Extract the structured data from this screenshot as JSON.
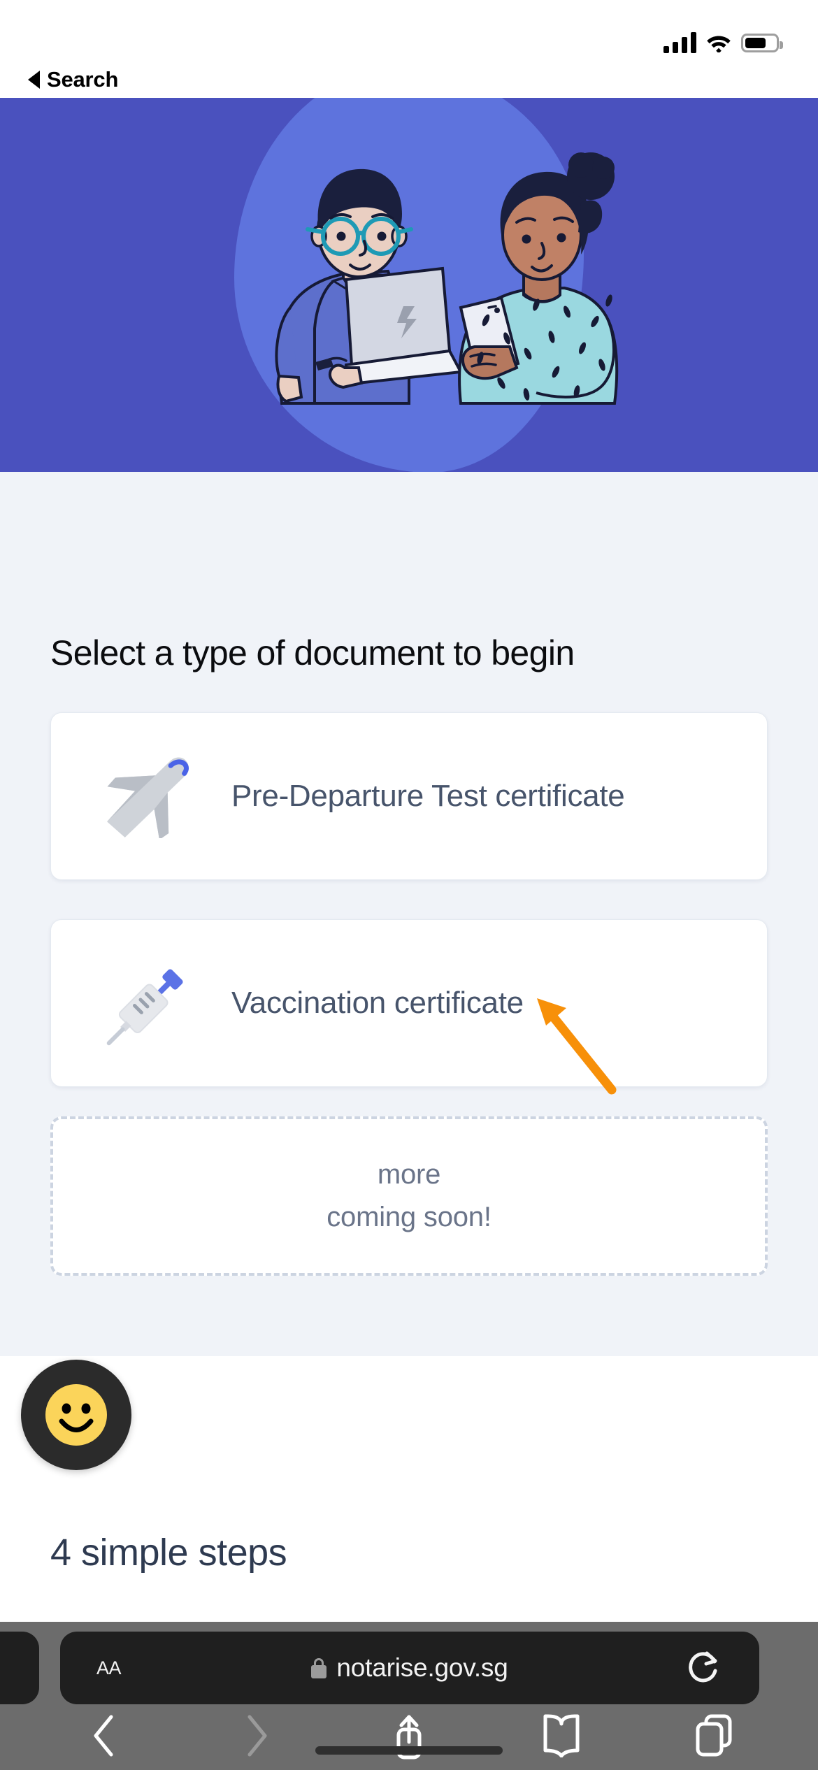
{
  "status_bar": {
    "signal_icon": "cellular-bars-icon",
    "wifi_icon": "wifi-icon",
    "battery_icon": "battery-icon"
  },
  "back_link": {
    "label": "Search",
    "icon": "back-triangle-icon"
  },
  "hero": {
    "background_color": "#4a51be",
    "blob_color": "#5e73dd",
    "illustration": "two-people-with-laptop-and-phone-illustration"
  },
  "page": {
    "background_color": "#f0f3f8",
    "heading": "Select a type of document to begin",
    "cards": [
      {
        "label": "Pre-Departure Test certificate",
        "icon": "airplane-icon",
        "icon_color": "#c9cdd3",
        "accent_color": "#4a63e7"
      },
      {
        "label": "Vaccination certificate",
        "icon": "syringe-icon",
        "icon_color": "#e3e5e9",
        "accent_color": "#5b72e6"
      }
    ],
    "coming_soon": {
      "line1": "more",
      "line2": "coming soon!",
      "border_color": "#ccd4e1",
      "text_color": "#6a7489"
    },
    "steps_title": "4 simple steps",
    "feedback_widget": {
      "icon": "smiley-face-icon",
      "face_color": "#fbd45a",
      "ring_color": "#2b2b2b"
    }
  },
  "annotation": {
    "arrow_icon": "orange-pointer-arrow-icon",
    "color": "#f79009",
    "points_to": "Vaccination certificate"
  },
  "safari": {
    "url": "notarise.gov.sg",
    "lock_icon": "lock-icon",
    "text_size_label": "AA",
    "reload_icon": "reload-icon",
    "toolbar": [
      {
        "name": "back",
        "icon": "chevron-left-icon",
        "enabled": true
      },
      {
        "name": "forward",
        "icon": "chevron-right-icon",
        "enabled": false
      },
      {
        "name": "share",
        "icon": "share-icon",
        "enabled": true
      },
      {
        "name": "bookmarks",
        "icon": "book-icon",
        "enabled": true
      },
      {
        "name": "tabs",
        "icon": "tabs-icon",
        "enabled": true
      }
    ],
    "home_indicator": "home-indicator"
  }
}
